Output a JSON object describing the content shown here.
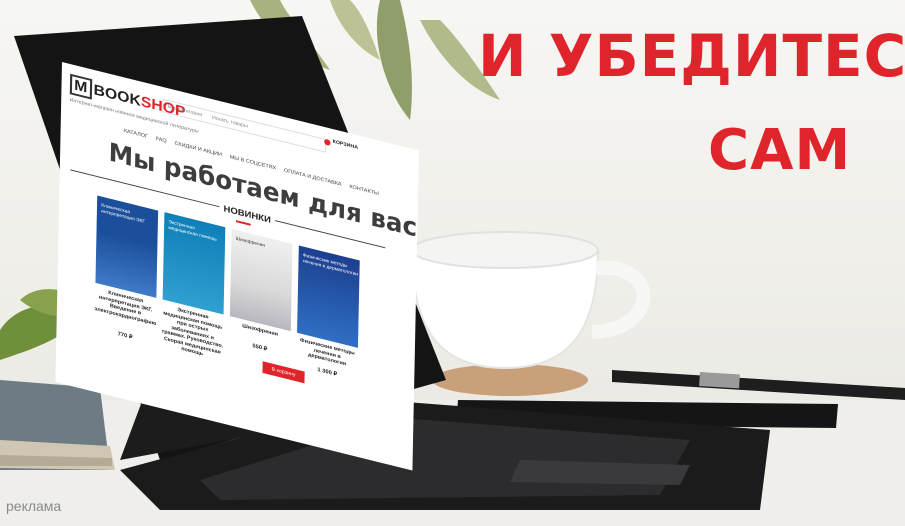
{
  "headline": {
    "line1": "И УБЕДИТЕС",
    "line2": "САМ"
  },
  "ad_label": "реклама",
  "site": {
    "logo_m": "M",
    "logo_book": "BOOK",
    "logo_shop": "SHOP",
    "tagline": "Интернет-магазин новинок медицинской литературы",
    "search_placeholder": "Искать товары",
    "search_scope": "Все категории",
    "cart_label": "КОРЗИНА",
    "nav": [
      "КАТАЛОГ",
      "FAQ",
      "СКИДКИ И АКЦИИ",
      "МЫ В СОЦСЕТЯХ",
      "ОПЛАТА И ДОСТАВКА",
      "КОНТАКТЫ"
    ],
    "hero": "Мы работаем для вас!",
    "section": "НОВИНКИ",
    "books": [
      {
        "cover": "Клиническая интерпретация ЭКГ",
        "title": "Клиническая интерпретация ЭКГ. Введение в электрокардиографию",
        "price": "770 ₽"
      },
      {
        "cover": "Экстренная медицинская помощь",
        "title": "Экстренная медицинская помощь при острых заболеваниях и травмах. Руководство. Скорая медицинская помощь",
        "price": ""
      },
      {
        "cover": "Шизофрения",
        "title": "Шизофрения",
        "price": "550 ₽"
      },
      {
        "cover": "Физические методы лечения в дерматологии",
        "title": "Физические методы лечения в дерматологии",
        "price": "1 300 ₽"
      }
    ],
    "cart_button": "В корзину"
  }
}
